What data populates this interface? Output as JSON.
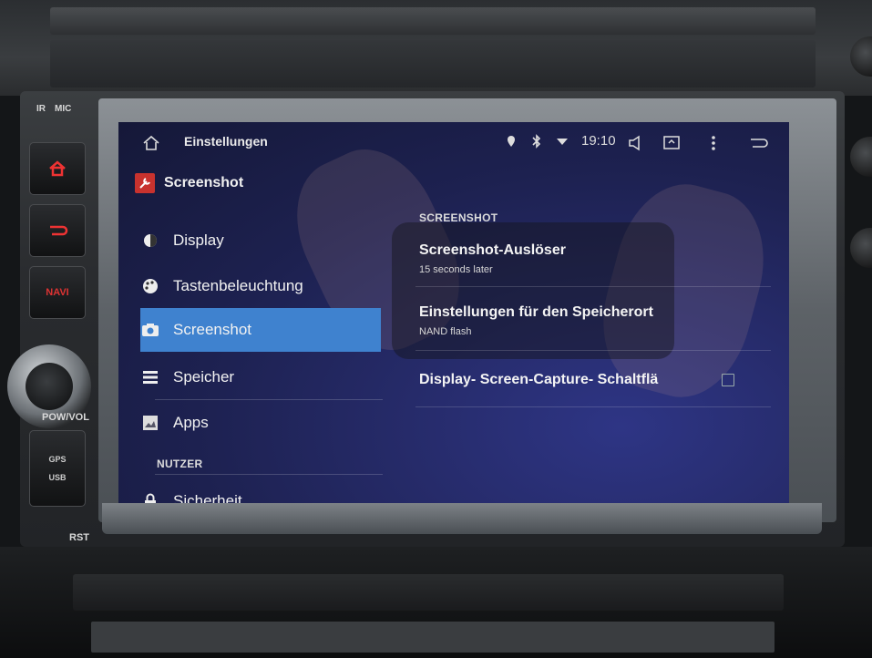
{
  "hardware": {
    "ir_label": "IR",
    "mic_label": "MIC",
    "navi_label": "NAVI",
    "pow_vol_label": "POW/VOL",
    "gps_label": "GPS",
    "usb_label": "USB",
    "rst_label": "RST",
    "buttons": [
      "home-icon",
      "back-icon"
    ]
  },
  "status_bar": {
    "title": "Einstellungen",
    "time": "19:10",
    "icons": [
      "location-icon",
      "bluetooth-icon",
      "wifi-icon",
      "volume-icon",
      "screenshot-icon",
      "overflow-menu-icon",
      "back-icon"
    ]
  },
  "left_pane": {
    "header": "Screenshot",
    "items": [
      {
        "label": "Display",
        "icon": "display-icon"
      },
      {
        "label": "Tastenbeleuchtung",
        "icon": "palette-icon"
      },
      {
        "label": "Screenshot",
        "icon": "camera-icon",
        "selected": true
      },
      {
        "label": "Speicher",
        "icon": "storage-icon"
      },
      {
        "label": "Apps",
        "icon": "apps-icon"
      }
    ],
    "section_user": "NUTZER",
    "partial_item": {
      "label": "Sicherheit",
      "icon": "lock-icon"
    }
  },
  "right_pane": {
    "section": "SCREENSHOT",
    "prefs": [
      {
        "title": "Screenshot-Auslöser",
        "summary": "15 seconds later"
      },
      {
        "title": "Einstellungen für den Speicherort",
        "summary": "NAND flash"
      },
      {
        "title": "Display- Screen-Capture- Schaltflä",
        "checked": false
      }
    ]
  },
  "colors": {
    "selected_item": "#3f82cf",
    "screen_background": "#1d2150",
    "hardware_accent": "#dd3333"
  }
}
